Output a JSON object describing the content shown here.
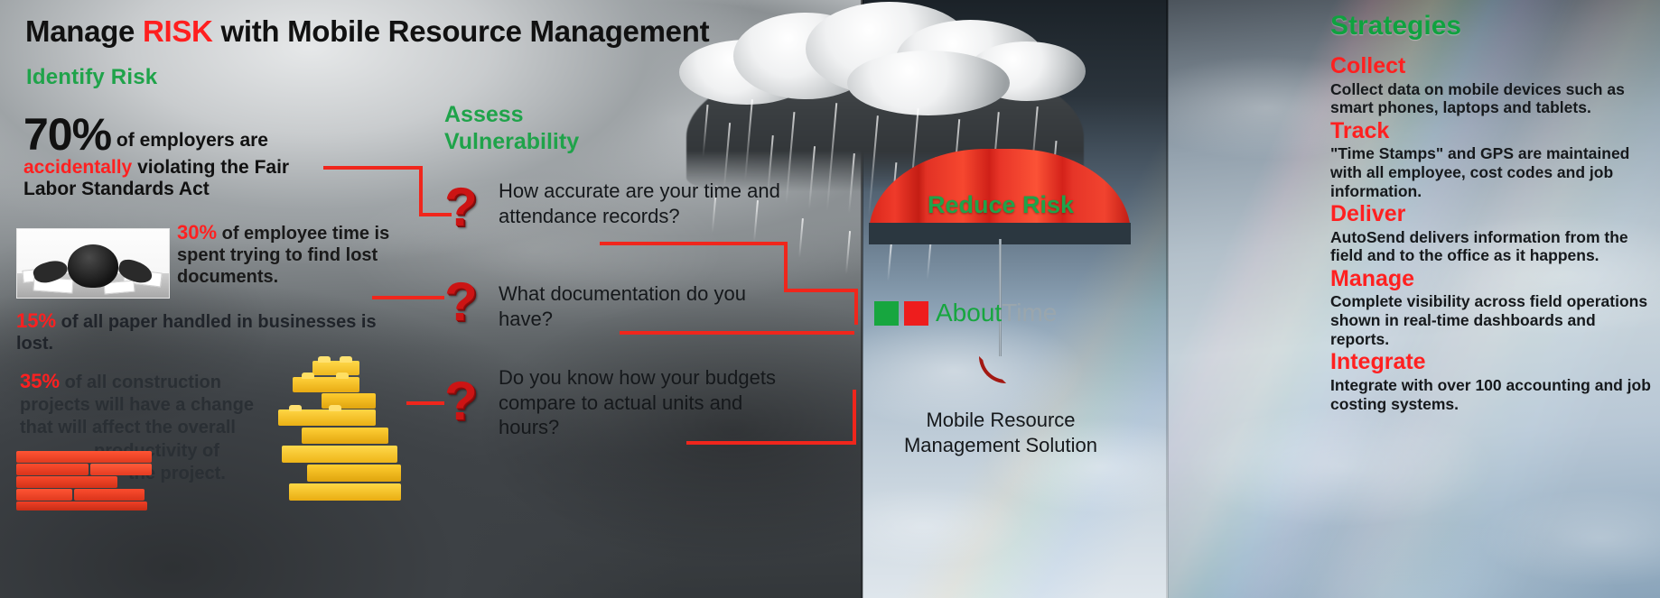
{
  "colors": {
    "risk_red": "#ff1f1f",
    "accent_red": "#f0261c",
    "green": "#1fa34a",
    "strategy_green": "#0fa23f",
    "text_dark": "#15181b"
  },
  "headline": {
    "part1": "Manage ",
    "risk": "RISK",
    "part2": " with Mobile Resource Management"
  },
  "identify": {
    "title": "Identify Risk",
    "stat_70": {
      "value": "70%",
      "line1": " of employers are",
      "emphasis": "accidentally",
      "line2": " violating the Fair",
      "line3": "Labor Standards Act"
    },
    "stat_30": {
      "value": "30%",
      "text": " of employee time is spent trying to find lost documents."
    },
    "stat_15": {
      "value": "15%",
      "text": " of all paper handled in businesses is lost."
    },
    "stat_35": {
      "value": "35%",
      "line1": " of all construction",
      "line2": "projects will have a change",
      "line3": "that will  affect the overall",
      "line4": "productivity of",
      "line5": "the project."
    }
  },
  "assess": {
    "title_line1": "Assess",
    "title_line2": "Vulnerability",
    "question_glyph": "?",
    "questions": [
      "How accurate are your time and attendance records?",
      "What documentation do you have?",
      "Do you know how your budgets compare to actual units and hours?"
    ]
  },
  "reduce": {
    "title": "Reduce Risk",
    "logo": {
      "about": "About",
      "time": "Time"
    },
    "caption_line1": "Mobile Resource",
    "caption_line2": "Management Solution"
  },
  "strategies": {
    "title": "Strategies",
    "items": [
      {
        "heading": "Collect",
        "body": "Collect data on mobile devices such as smart phones, laptops and tablets."
      },
      {
        "heading": "Track",
        "body": "\"Time Stamps\" and GPS are maintained with all employee, cost codes and job information."
      },
      {
        "heading": "Deliver",
        "body": "AutoSend delivers information from the field and to the office as it happens."
      },
      {
        "heading": "Manage",
        "body": "Complete visibility across field operations shown in real-time dashboards and reports."
      },
      {
        "heading": "Integrate",
        "body": "Integrate with over 100 accounting and job costing systems."
      }
    ]
  }
}
